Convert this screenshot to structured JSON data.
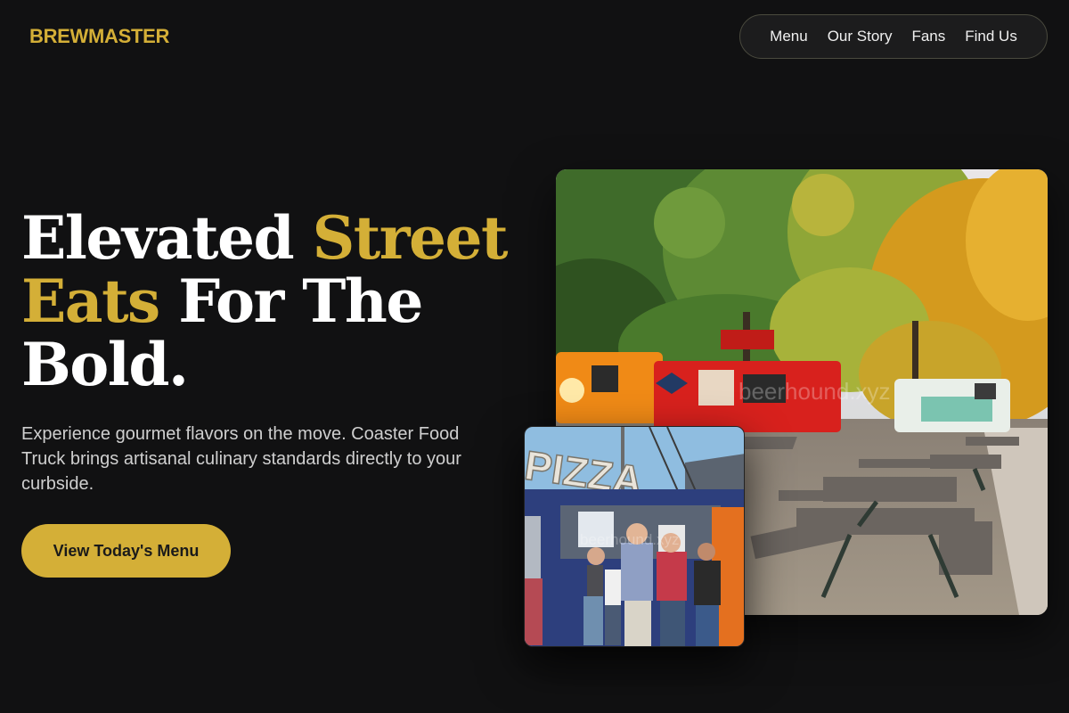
{
  "brand": {
    "logo_text": "BREWMASTER"
  },
  "nav": {
    "items": [
      "Menu",
      "Our Story",
      "Fans",
      "Find Us"
    ]
  },
  "hero": {
    "title_part1": "Elevated ",
    "title_gold1": "Street",
    "title_gold2": "Eats",
    "title_part2": " For The",
    "title_part3": "Bold.",
    "subtitle": "Experience gourmet flavors on the move. Coaster Food Truck brings artisanal culinary standards directly to your curbside.",
    "cta_label": "View Today's Menu"
  },
  "images": {
    "main_watermark": "beerhound.xyz",
    "small_watermark": "beerhound.xyz",
    "small_sign": "PIZZA"
  },
  "colors": {
    "background": "#111112",
    "accent_gold": "#d4af37",
    "text": "#ffffff",
    "muted_text": "#cfcfcf"
  }
}
